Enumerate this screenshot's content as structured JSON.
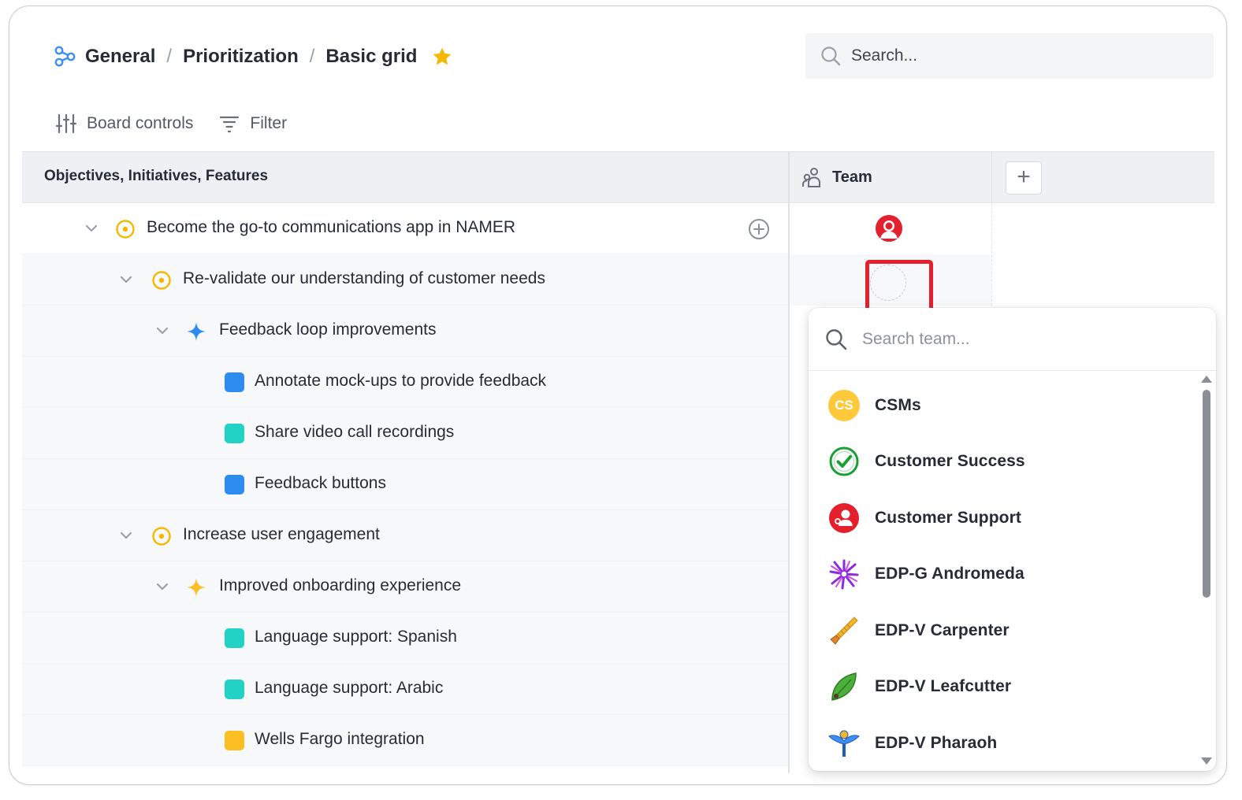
{
  "breadcrumb": {
    "items": [
      "General",
      "Prioritization",
      "Basic grid"
    ],
    "separator": "/"
  },
  "search": {
    "placeholder": "Search..."
  },
  "toolbar": {
    "board_controls": "Board controls",
    "filter": "Filter"
  },
  "grid": {
    "main_column_header": "Objectives, Initiatives, Features",
    "team_column_header": "Team",
    "add_column_label": "+"
  },
  "rows": [
    {
      "label": "Become the go-to communications app in NAMER",
      "type": "objective",
      "level": 0
    },
    {
      "label": "Re-validate our understanding of customer needs",
      "type": "objective",
      "level": 1
    },
    {
      "label": "Feedback loop improvements",
      "type": "initiative",
      "level": 2,
      "color": "#2d8cf0"
    },
    {
      "label": "Annotate mock-ups to provide feedback",
      "type": "feature",
      "level": 3,
      "color": "#2d8cf0"
    },
    {
      "label": "Share video call recordings",
      "type": "feature",
      "level": 3,
      "color": "#22d3c5"
    },
    {
      "label": "Feedback buttons",
      "type": "feature",
      "level": 3,
      "color": "#2d8cf0"
    },
    {
      "label": "Increase user engagement",
      "type": "objective",
      "level": 1
    },
    {
      "label": "Improved onboarding experience",
      "type": "initiative",
      "level": 2,
      "color": "#fbbf24"
    },
    {
      "label": "Language support: Spanish",
      "type": "feature",
      "level": 3,
      "color": "#22d3c5"
    },
    {
      "label": "Language support: Arabic",
      "type": "feature",
      "level": 3,
      "color": "#22d3c5"
    },
    {
      "label": "Wells Fargo integration",
      "type": "feature",
      "level": 3,
      "color": "#fbbf24"
    }
  ],
  "team_dropdown": {
    "placeholder": "Search team...",
    "items": [
      {
        "name": "CSMs",
        "icon": "cs-initials-badge",
        "initials": "CS"
      },
      {
        "name": "Customer Success",
        "icon": "green-check-icon"
      },
      {
        "name": "Customer Support",
        "icon": "red-support-icon"
      },
      {
        "name": "EDP-G Andromeda",
        "icon": "purple-galaxy-icon"
      },
      {
        "name": "EDP-V Carpenter",
        "icon": "saw-icon"
      },
      {
        "name": "EDP-V Leafcutter",
        "icon": "leaf-icon"
      },
      {
        "name": "EDP-V Pharaoh",
        "icon": "winged-emblem-icon"
      }
    ]
  },
  "colors": {
    "accent_yellow": "#f5b700",
    "highlight_red": "#e3202b",
    "feature_blue": "#2d8cf0",
    "feature_teal": "#22d3c5",
    "feature_yellow": "#fbbf24"
  }
}
